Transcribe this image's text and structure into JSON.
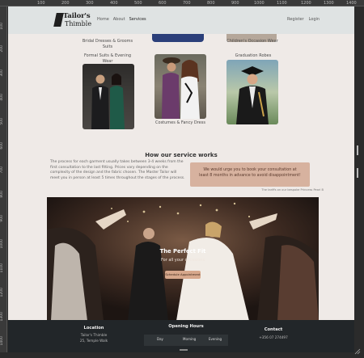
{
  "ruler": {
    "top_marks": [
      "100",
      "200",
      "300",
      "400",
      "500",
      "600",
      "700",
      "800",
      "900",
      "1000",
      "1100",
      "1200",
      "1300",
      "1400"
    ],
    "left_marks": [
      "100",
      "200",
      "300",
      "400",
      "500",
      "600",
      "700",
      "800",
      "900",
      "1000",
      "1100",
      "1200",
      "1300",
      "1400"
    ]
  },
  "nav": {
    "logo_line1": "Tailor's",
    "logo_line2": "Thimble",
    "links": [
      "Home",
      "About",
      "Services"
    ],
    "active_link": "Services",
    "right_links": [
      "Register",
      "Login"
    ]
  },
  "top_captions": {
    "left": "Bridal Dresses & Grooms Suits",
    "right": "Children's Occasion Wear"
  },
  "categories": [
    {
      "title": "Formal Suits & Evening Wear",
      "caption": ""
    },
    {
      "title": "",
      "caption": "Costumes & Fancy Dress"
    },
    {
      "title": "Graduation Robes",
      "caption": ""
    }
  ],
  "how": {
    "title": "How our service works",
    "text": "The process for each garment usually takes between 3-4 weeks from the first consultation to the last fitting. Prices vary depending on the complexity of the design and the fabric chosen. The Master Tailor will meet you in person at least 5 times throughout the stages of the process.",
    "urge": "We would urge you to book your consultation at least 8 months in advance to avoid disappointment!",
    "note": "The tariffs on our bespoke Princess Pearl B"
  },
  "hero": {
    "title": "The Perfect Fit",
    "subtitle": "For all your occasions",
    "button": "Schedule Appointment"
  },
  "footer": {
    "location_title": "Location",
    "location_line1": "Tailor's Thimble",
    "location_line2": "25, Temple Walk",
    "hours_title": "Opening Hours",
    "hours_cols": [
      "Day",
      "Morning",
      "Evening"
    ],
    "contact_title": "Contact",
    "contact_phone": "+356 07 274497"
  },
  "colors": {
    "page_bg": "#efeae7",
    "nav_bg": "#dfe3e3",
    "accent": "#d7b29f",
    "footer_bg": "#222629"
  }
}
